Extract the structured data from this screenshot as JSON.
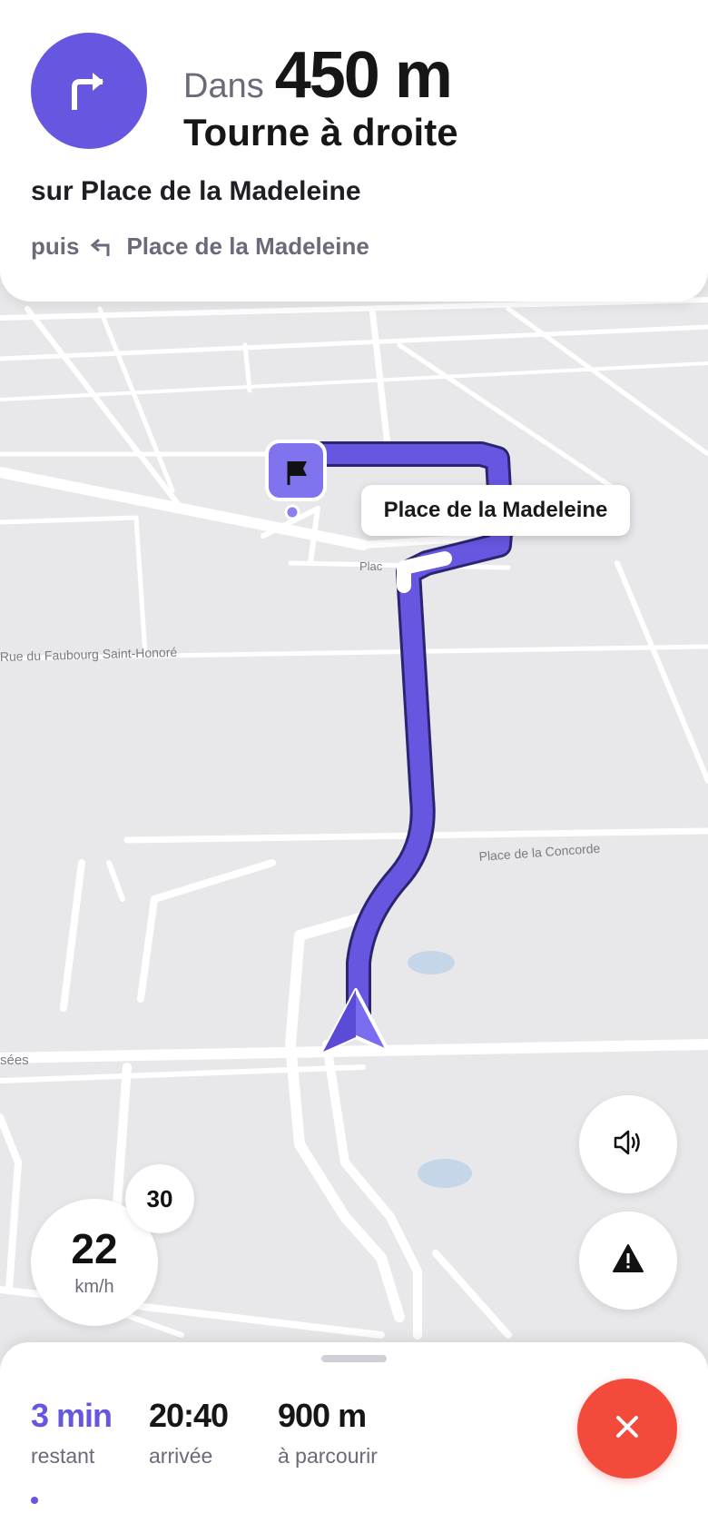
{
  "instruction": {
    "prefix": "Dans",
    "distance": "450 m",
    "maneuver": "Tourne à droite",
    "street": "sur Place de la Madeleine",
    "then_word": "puis",
    "then_street": "Place de la Madeleine"
  },
  "map": {
    "bubble_label": "Place de la Madeleine",
    "street_labels": {
      "faubourg": "Rue du Faubourg Saint-Honoré",
      "concorde": "Place de la Concorde",
      "elysees": "sées",
      "place": "Plac"
    }
  },
  "speed": {
    "current": "22",
    "unit": "km/h",
    "limit": "30"
  },
  "trip": {
    "remaining_value": "3 min",
    "remaining_label": "restant",
    "arrival_value": "20:40",
    "arrival_label": "arrivée",
    "distance_value": "900 m",
    "distance_label": "à parcourir"
  },
  "icons": {
    "turn": "turn-right-icon",
    "then": "turn-left-icon",
    "sound": "speaker-icon",
    "report": "warning-icon",
    "close": "close-icon",
    "destination": "flag-icon",
    "position": "navigation-arrow-icon"
  },
  "colors": {
    "accent": "#6656e0",
    "danger": "#f44a3c",
    "map_bg": "#e8e8eb",
    "road": "#ffffff"
  }
}
